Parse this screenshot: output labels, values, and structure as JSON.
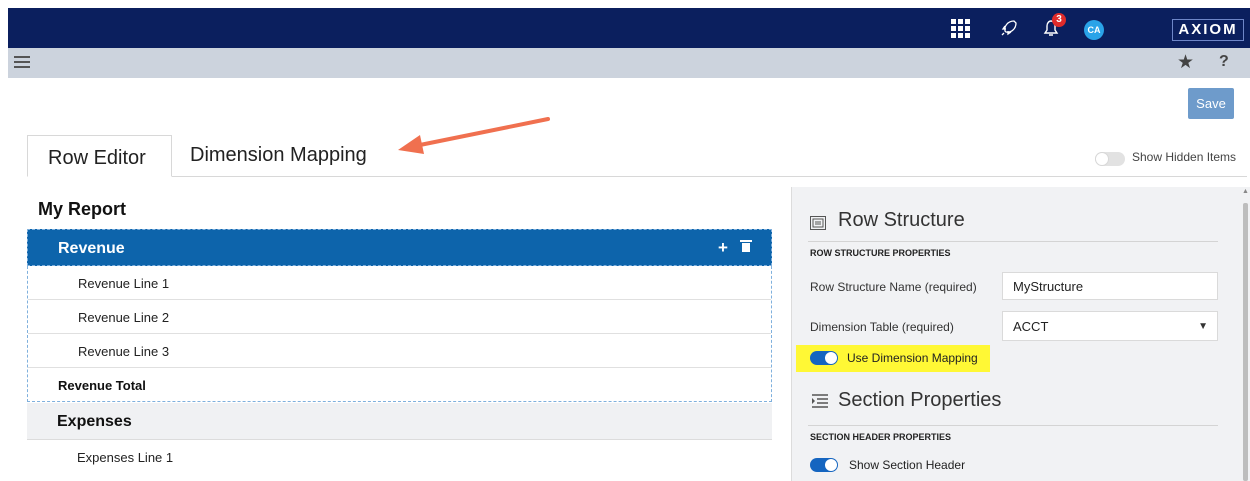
{
  "topbar": {
    "notification_count": "3",
    "user_initials": "CA",
    "brand": "AXIOM",
    "icons": [
      "apps-grid-icon",
      "rocket-icon",
      "bell-icon"
    ]
  },
  "subbar": {
    "icons": [
      "hamburger-menu-icon",
      "star-icon",
      "help-icon"
    ],
    "help_glyph": "?"
  },
  "actions": {
    "save_label": "Save"
  },
  "tabs": [
    {
      "label": "Row Editor",
      "active": true
    },
    {
      "label": "Dimension Mapping",
      "active": false
    }
  ],
  "show_hidden": {
    "label": "Show Hidden Items",
    "on": false
  },
  "report": {
    "title": "My Report",
    "sections": [
      {
        "header": "Revenue",
        "selected": true,
        "lines": [
          "Revenue Line 1",
          "Revenue Line 2",
          "Revenue Line 3"
        ],
        "total": "Revenue Total"
      },
      {
        "header": "Expenses",
        "selected": false,
        "lines": [
          "Expenses Line 1"
        ]
      }
    ]
  },
  "panel": {
    "row_structure": {
      "title": "Row Structure",
      "subheading": "ROW STRUCTURE PROPERTIES",
      "name_label": "Row Structure Name (required)",
      "name_value": "MyStructure",
      "dim_table_label": "Dimension Table (required)",
      "dim_table_value": "ACCT",
      "use_dim_mapping_label": "Use Dimension Mapping",
      "use_dim_mapping_on": true
    },
    "section_properties": {
      "title": "Section Properties",
      "subheading": "SECTION HEADER PROPERTIES",
      "show_header_label": "Show Section Header",
      "show_header_on": true
    }
  },
  "colors": {
    "topbar": "#0b1f5e",
    "selected_section": "#0d64ab",
    "annotation_arrow": "#f0704f",
    "highlight": "#fff835"
  }
}
